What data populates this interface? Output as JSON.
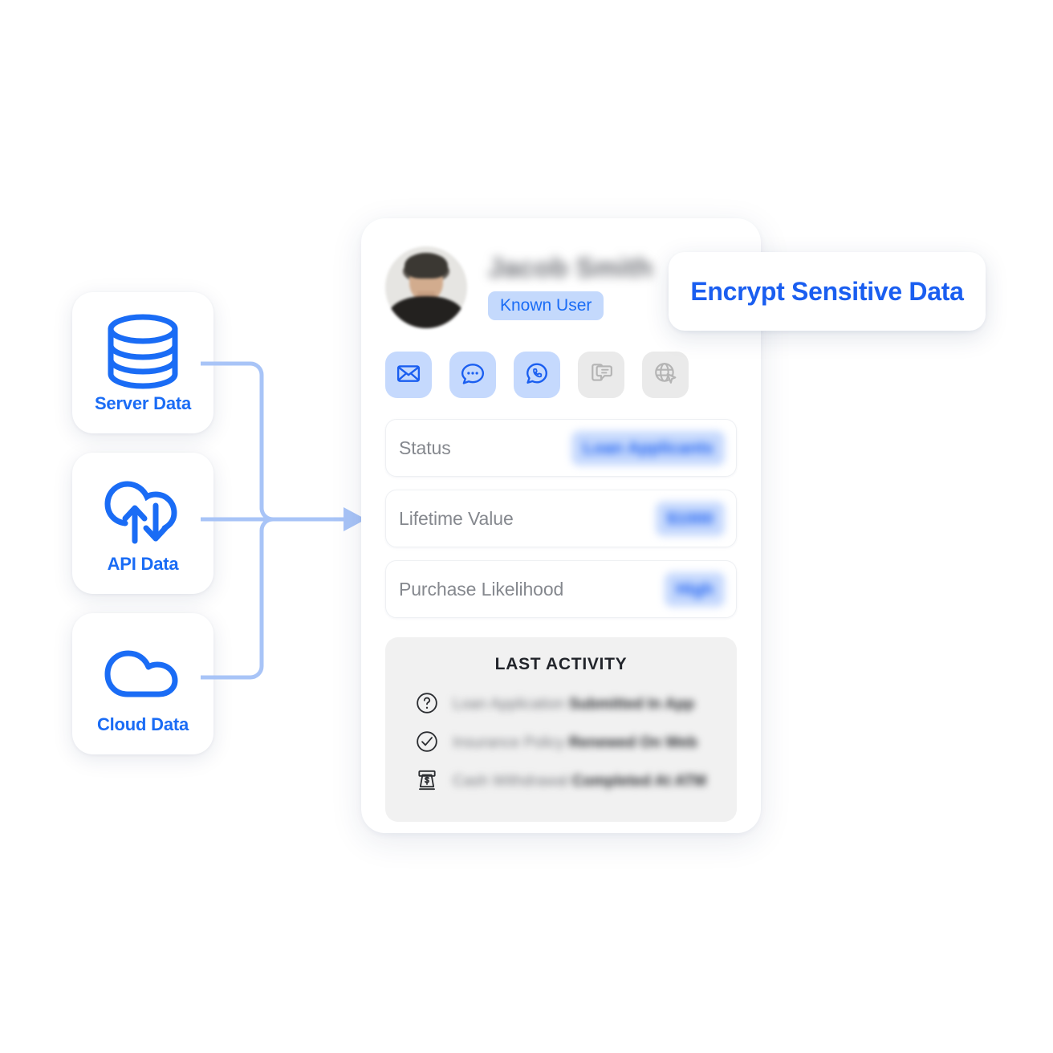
{
  "sources": [
    {
      "id": "server",
      "label": "Server Data",
      "icon": "database-icon"
    },
    {
      "id": "api",
      "label": "API Data",
      "icon": "cloud-sync-icon"
    },
    {
      "id": "cloud",
      "label": "Cloud Data",
      "icon": "cloud-icon"
    }
  ],
  "profile": {
    "name": "Jacob Smith",
    "badge": "Known User",
    "avatar_alt": "user-photo",
    "channels": [
      {
        "id": "email",
        "icon": "envelope-icon",
        "enabled": true
      },
      {
        "id": "chat",
        "icon": "chat-bubble-icon",
        "enabled": true
      },
      {
        "id": "whatsapp",
        "icon": "whatsapp-icon",
        "enabled": true
      },
      {
        "id": "sms",
        "icon": "sms-device-icon",
        "enabled": false
      },
      {
        "id": "web",
        "icon": "globe-cursor-icon",
        "enabled": false
      }
    ],
    "attributes": [
      {
        "label": "Status",
        "value": "Loan Applicants"
      },
      {
        "label": "Lifetime Value",
        "value": "$1000"
      },
      {
        "label": "Purchase Likelihood",
        "value": "High"
      }
    ],
    "activity": {
      "title": "LAST ACTIVITY",
      "items": [
        {
          "icon": "question-circle-icon",
          "subject": "Loan Application",
          "detail": "Submitted In App"
        },
        {
          "icon": "check-circle-icon",
          "subject": "Insurance Policy",
          "detail": "Renewed On Web"
        },
        {
          "icon": "atm-cash-icon",
          "subject": "Cash Withdrawal",
          "detail": "Completed At ATM"
        }
      ]
    }
  },
  "callout": {
    "label": "Encrypt Sensitive Data"
  },
  "colors": {
    "brand_blue": "#1a6cf5",
    "deep_blue": "#1a5ef0",
    "pill_blue": "#c5d9fd",
    "connector_blue": "#a8c4f7",
    "muted_gray": "#85888e",
    "panel_gray": "#f1f1f1",
    "disabled_gray": "#eaeaea"
  }
}
